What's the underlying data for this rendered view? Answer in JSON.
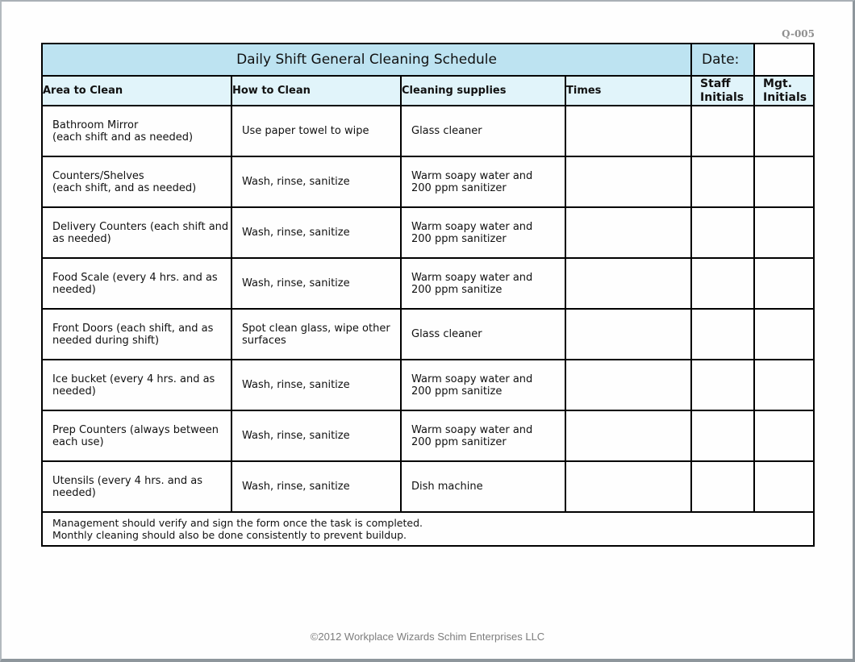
{
  "form_code": "Q-005",
  "title": "Daily Shift General Cleaning Schedule",
  "date_label": "Date:",
  "date_value": "",
  "columns": [
    "Area to Clean",
    "How to Clean",
    "Cleaning supplies",
    "Times",
    "Staff Initials",
    "Mgt. Initials"
  ],
  "rows": [
    {
      "area": "Bathroom Mirror",
      "area_note": "(each shift and as needed)",
      "how": "Use paper towel to wipe",
      "supplies": "Glass cleaner",
      "times": "",
      "staff": "",
      "mgt": ""
    },
    {
      "area": "Counters/Shelves",
      "area_note": "(each shift, and as needed)",
      "how": "Wash, rinse, sanitize",
      "supplies": "Warm soapy water and 200 ppm sanitizer",
      "times": "",
      "staff": "",
      "mgt": ""
    },
    {
      "area": "Delivery Counters (each shift and as needed)",
      "area_note": "",
      "how": "Wash, rinse, sanitize",
      "supplies": "Warm soapy water and 200 ppm sanitizer",
      "times": "",
      "staff": "",
      "mgt": ""
    },
    {
      "area": "Food Scale (every 4 hrs. and as needed)",
      "area_note": "",
      "how": "Wash, rinse, sanitize",
      "supplies": "Warm soapy water and 200 ppm sanitize",
      "times": "",
      "staff": "",
      "mgt": ""
    },
    {
      "area": "Front Doors (each shift, and as needed during shift)",
      "area_note": "",
      "how": "Spot clean glass, wipe other surfaces",
      "supplies": "Glass cleaner",
      "times": "",
      "staff": "",
      "mgt": ""
    },
    {
      "area": "Ice bucket (every 4 hrs. and as needed)",
      "area_note": "",
      "how": "Wash, rinse, sanitize",
      "supplies": "Warm soapy water and 200 ppm sanitize",
      "times": "",
      "staff": "",
      "mgt": ""
    },
    {
      "area": "Prep Counters (always between each use)",
      "area_note": "",
      "how": "Wash, rinse, sanitize",
      "supplies": "Warm soapy water and 200 ppm sanitizer",
      "times": "",
      "staff": "",
      "mgt": ""
    },
    {
      "area": "Utensils (every 4 hrs. and as needed)",
      "area_note": "",
      "how": "Wash, rinse, sanitize",
      "supplies": "Dish machine",
      "times": "",
      "staff": "",
      "mgt": ""
    }
  ],
  "notes": [
    "Management should verify and sign the form once the task is completed.",
    "Monthly cleaning should also be done consistently to prevent buildup."
  ],
  "copyright": "©2012 Workplace Wizards Schim Enterprises LLC"
}
